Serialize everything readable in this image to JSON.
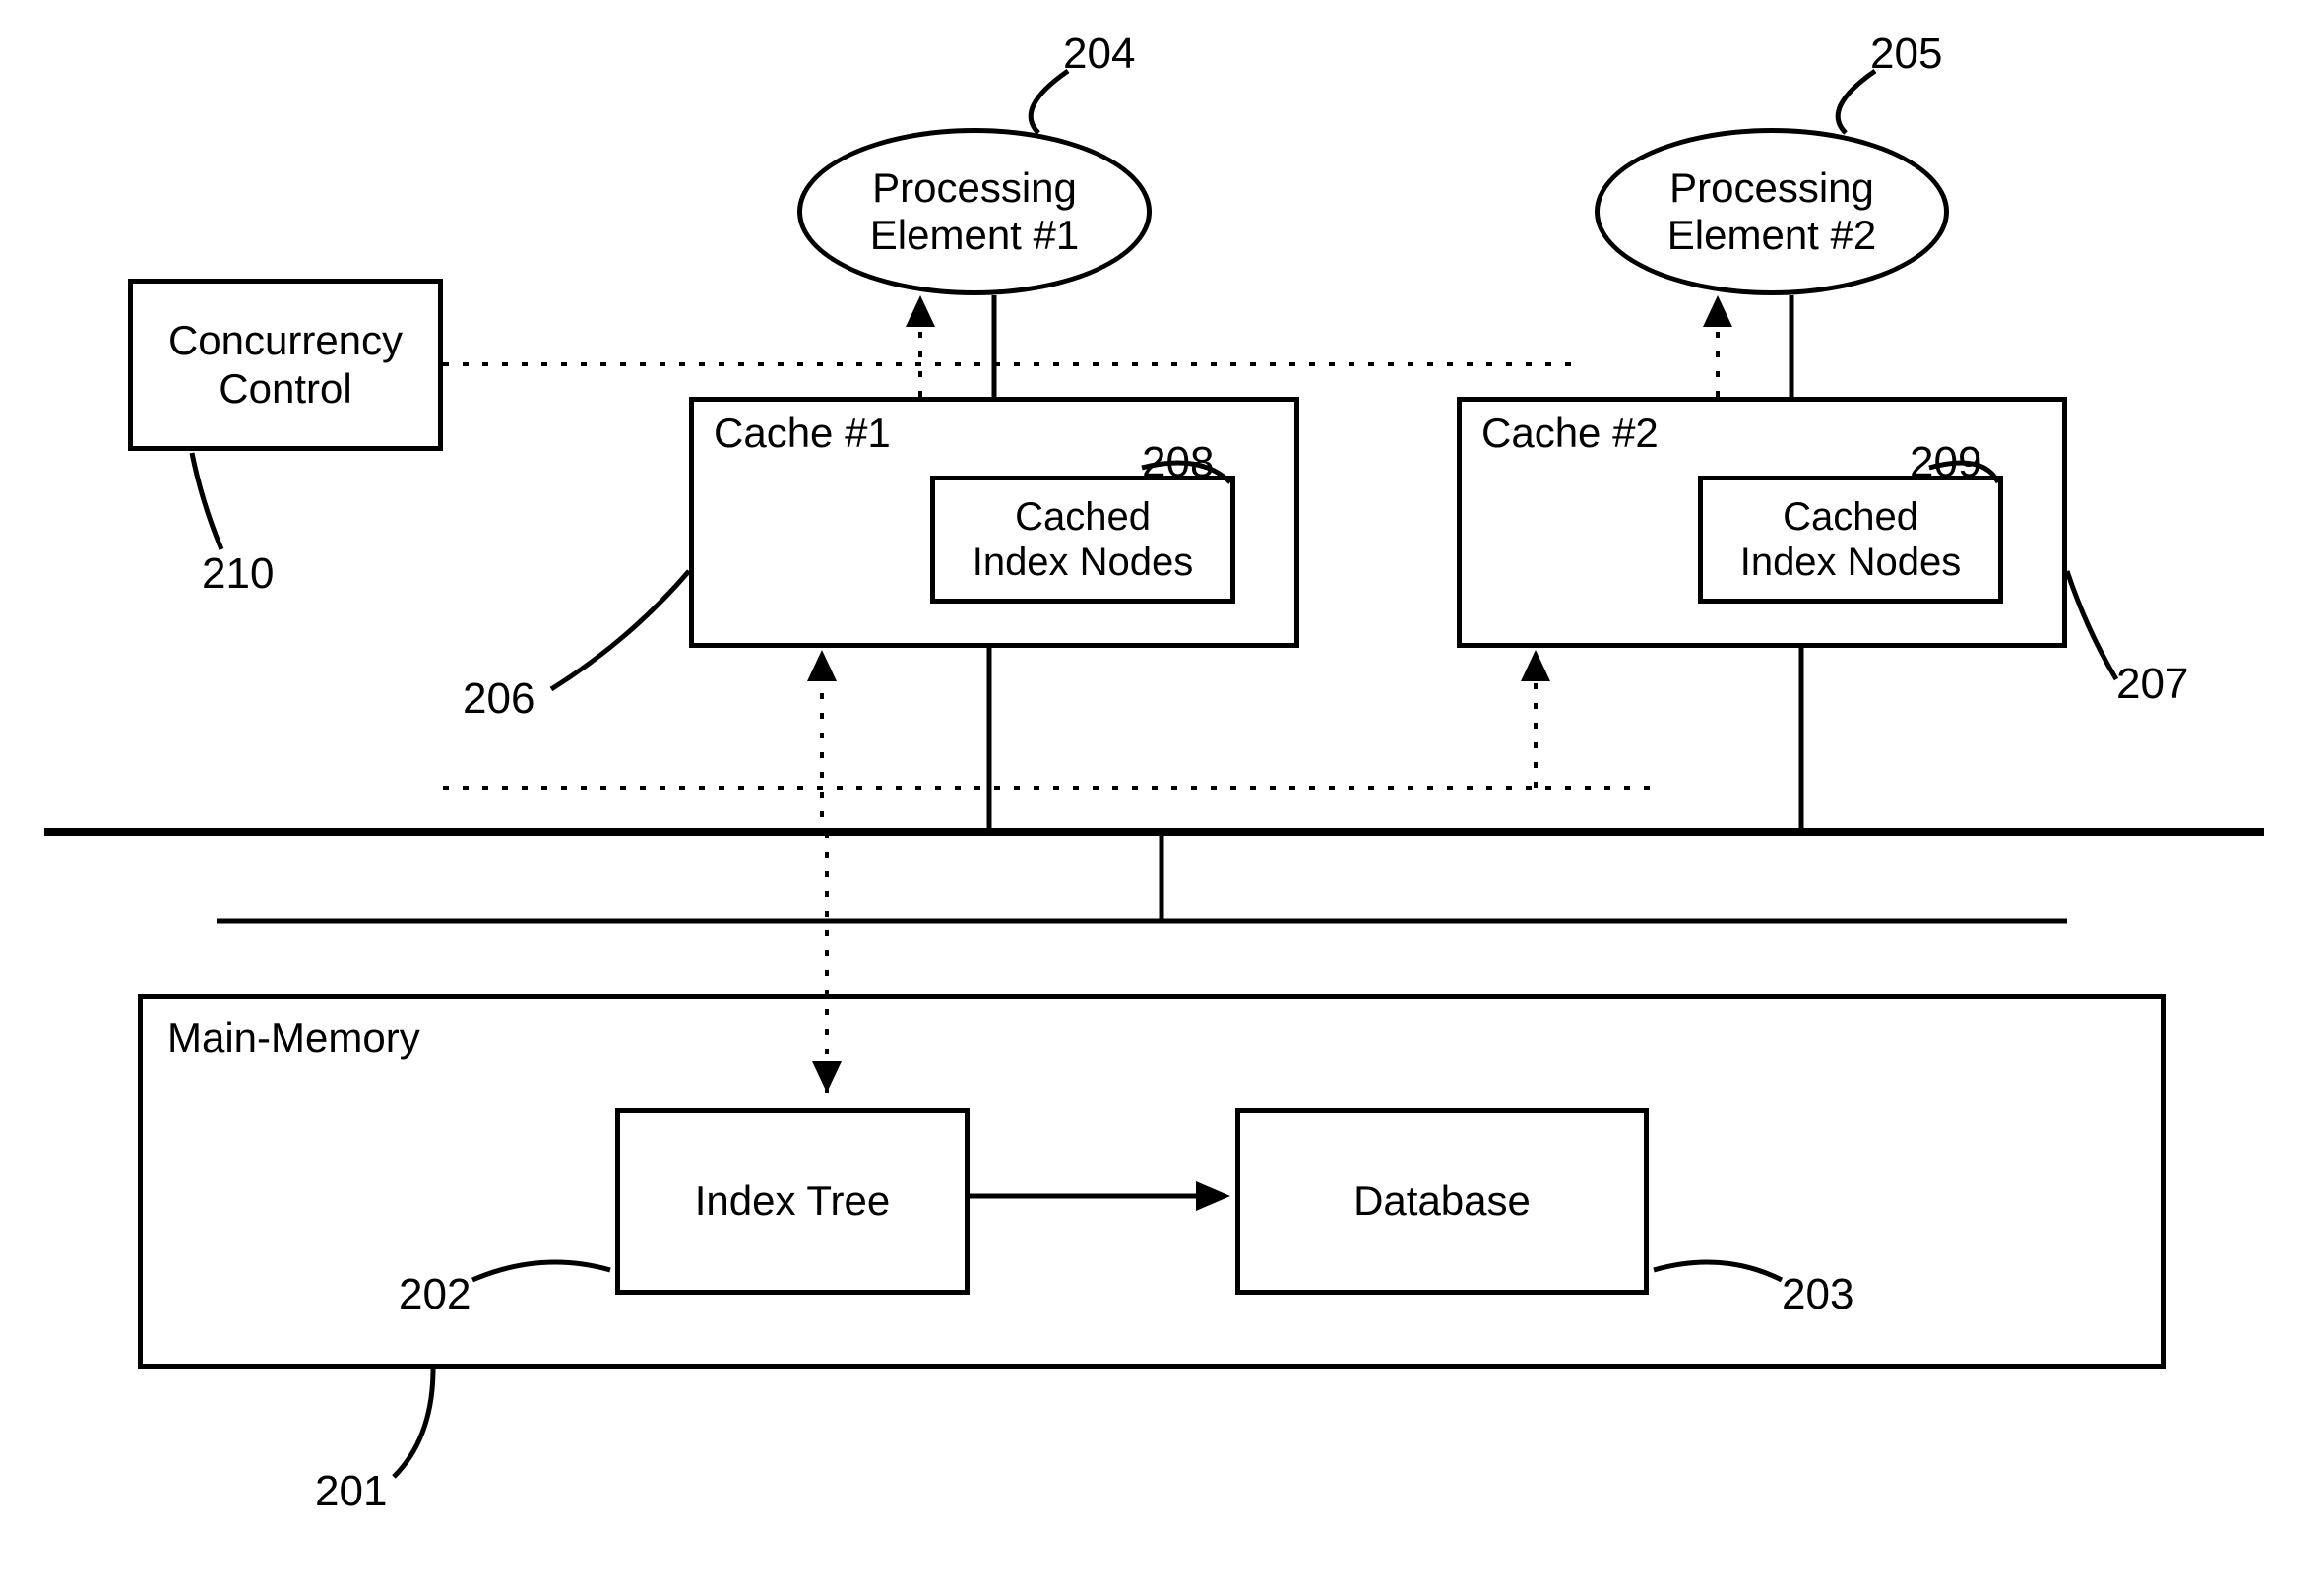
{
  "diagram": {
    "concurrency_control": {
      "label": "Concurrency\nControl",
      "ref": "210"
    },
    "processing_element_1": {
      "label": "Processing\nElement #1",
      "ref": "204"
    },
    "processing_element_2": {
      "label": "Processing\nElement #2",
      "ref": "205"
    },
    "cache_1": {
      "title": "Cache #1",
      "ref": "206",
      "cached_index_nodes": {
        "label": "Cached\nIndex Nodes",
        "ref": "208"
      }
    },
    "cache_2": {
      "title": "Cache #2",
      "ref": "207",
      "cached_index_nodes": {
        "label": "Cached\nIndex Nodes",
        "ref": "209"
      }
    },
    "main_memory": {
      "title": "Main-Memory",
      "ref": "201",
      "index_tree": {
        "label": "Index Tree",
        "ref": "202"
      },
      "database": {
        "label": "Database",
        "ref": "203"
      }
    }
  }
}
